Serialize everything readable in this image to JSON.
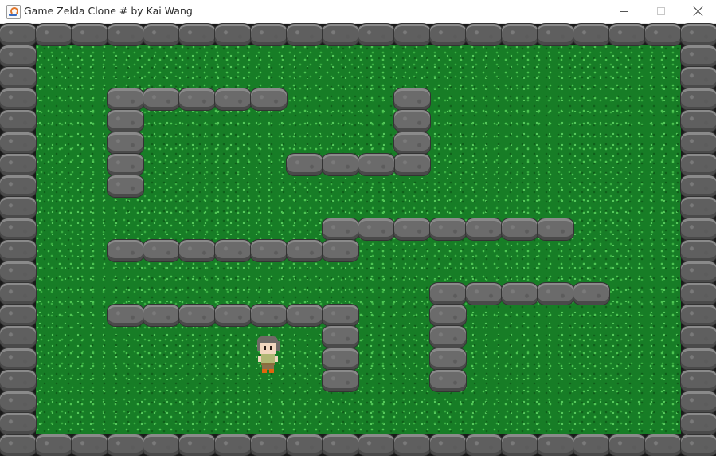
{
  "window": {
    "title": "Game Zelda Clone # by Kai Wang",
    "icon": "java-cup-icon",
    "controls": [
      "minimize",
      "maximize",
      "close"
    ]
  },
  "game": {
    "grid": {
      "cols": 20,
      "rows": 20
    },
    "tiles": {
      "floor": "grass",
      "wall": "rock"
    },
    "colors": {
      "grass": "#177d26",
      "rock": "#6b6b6b",
      "border": "#1a1a1a"
    },
    "walls": [
      [
        3,
        3
      ],
      [
        4,
        3
      ],
      [
        5,
        3
      ],
      [
        6,
        3
      ],
      [
        7,
        3
      ],
      [
        3,
        4
      ],
      [
        3,
        5
      ],
      [
        3,
        6
      ],
      [
        3,
        7
      ],
      [
        11,
        3
      ],
      [
        11,
        4
      ],
      [
        11,
        5
      ],
      [
        11,
        6
      ],
      [
        8,
        6
      ],
      [
        9,
        6
      ],
      [
        10,
        6
      ],
      [
        9,
        9
      ],
      [
        10,
        9
      ],
      [
        11,
        9
      ],
      [
        12,
        9
      ],
      [
        13,
        9
      ],
      [
        14,
        9
      ],
      [
        15,
        9
      ],
      [
        3,
        10
      ],
      [
        4,
        10
      ],
      [
        5,
        10
      ],
      [
        6,
        10
      ],
      [
        7,
        10
      ],
      [
        8,
        10
      ],
      [
        9,
        10
      ],
      [
        12,
        12
      ],
      [
        13,
        12
      ],
      [
        14,
        12
      ],
      [
        15,
        12
      ],
      [
        16,
        12
      ],
      [
        12,
        13
      ],
      [
        12,
        14
      ],
      [
        12,
        15
      ],
      [
        12,
        16
      ],
      [
        3,
        13
      ],
      [
        4,
        13
      ],
      [
        5,
        13
      ],
      [
        6,
        13
      ],
      [
        7,
        13
      ],
      [
        8,
        13
      ],
      [
        9,
        13
      ],
      [
        9,
        14
      ],
      [
        9,
        15
      ],
      [
        9,
        16
      ]
    ],
    "player": {
      "tile": [
        7,
        15
      ],
      "facing": "down"
    }
  }
}
